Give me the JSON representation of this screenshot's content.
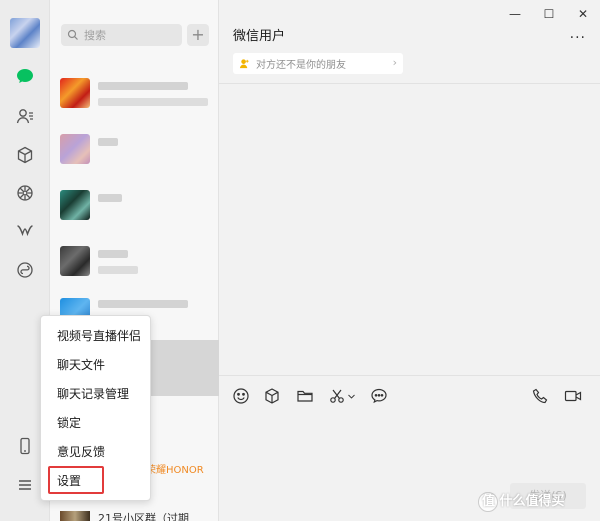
{
  "search": {
    "placeholder": "搜索"
  },
  "add_label": "+",
  "menu": {
    "items": [
      "视频号直播伴侣",
      "聊天文件",
      "聊天记录管理",
      "锁定",
      "意见反馈",
      "设置"
    ]
  },
  "list": {
    "honor_text": "荣耀HONOR",
    "bottom_text": "21号小区群（过期"
  },
  "chat": {
    "title": "微信用户",
    "more": "···",
    "notice": "对方还不是你的朋友",
    "send_label": "发送(S)"
  },
  "window": {
    "minimize": "—",
    "maximize": "☐",
    "close": "✕"
  },
  "watermark": "值 什么值得买",
  "colors": {
    "accent_green": "#07c160",
    "highlight_red": "#e23b3b",
    "honor_orange": "#f08a24"
  },
  "icons": {
    "nav": [
      "chat-icon",
      "contacts-icon",
      "favorites-icon",
      "moments-icon",
      "channels-icon",
      "mini-programs-icon",
      "phone-icon",
      "menu-icon"
    ],
    "toolbar": [
      "emoji-icon",
      "package-icon",
      "folder-icon",
      "scissors-icon",
      "chevron-down-icon",
      "chat-bubble-icon",
      "voice-call-icon",
      "video-call-icon"
    ]
  }
}
